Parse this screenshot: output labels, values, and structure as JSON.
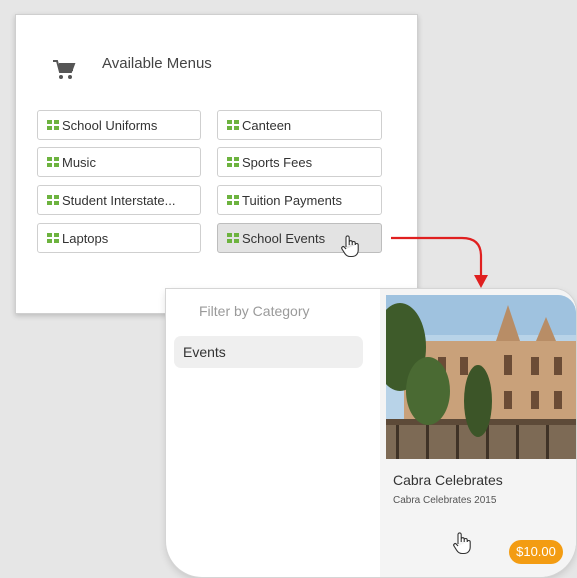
{
  "menus": {
    "title": "Available Menus",
    "icon": "shopping-cart-icon",
    "buttons": [
      {
        "label": "School Uniforms",
        "icon": "grid-icon"
      },
      {
        "label": "Canteen",
        "icon": "grid-icon"
      },
      {
        "label": "Music",
        "icon": "grid-icon"
      },
      {
        "label": "Sports Fees",
        "icon": "grid-icon"
      },
      {
        "label": "Student Interstate...",
        "icon": "grid-icon"
      },
      {
        "label": "Tuition Payments",
        "icon": "grid-icon"
      },
      {
        "label": "Laptops",
        "icon": "grid-icon"
      },
      {
        "label": "School Events",
        "icon": "grid-icon",
        "active": true
      }
    ]
  },
  "filter": {
    "title": "Filter by Category",
    "items": [
      {
        "label": "Events",
        "selected": true
      }
    ]
  },
  "product": {
    "name": "Cabra Celebrates",
    "subtitle": "Cabra Celebrates 2015",
    "price": "$10.00"
  },
  "colors": {
    "grid_icon": "#6db33f",
    "arrow": "#e02020",
    "price_badge": "#f39c12"
  }
}
